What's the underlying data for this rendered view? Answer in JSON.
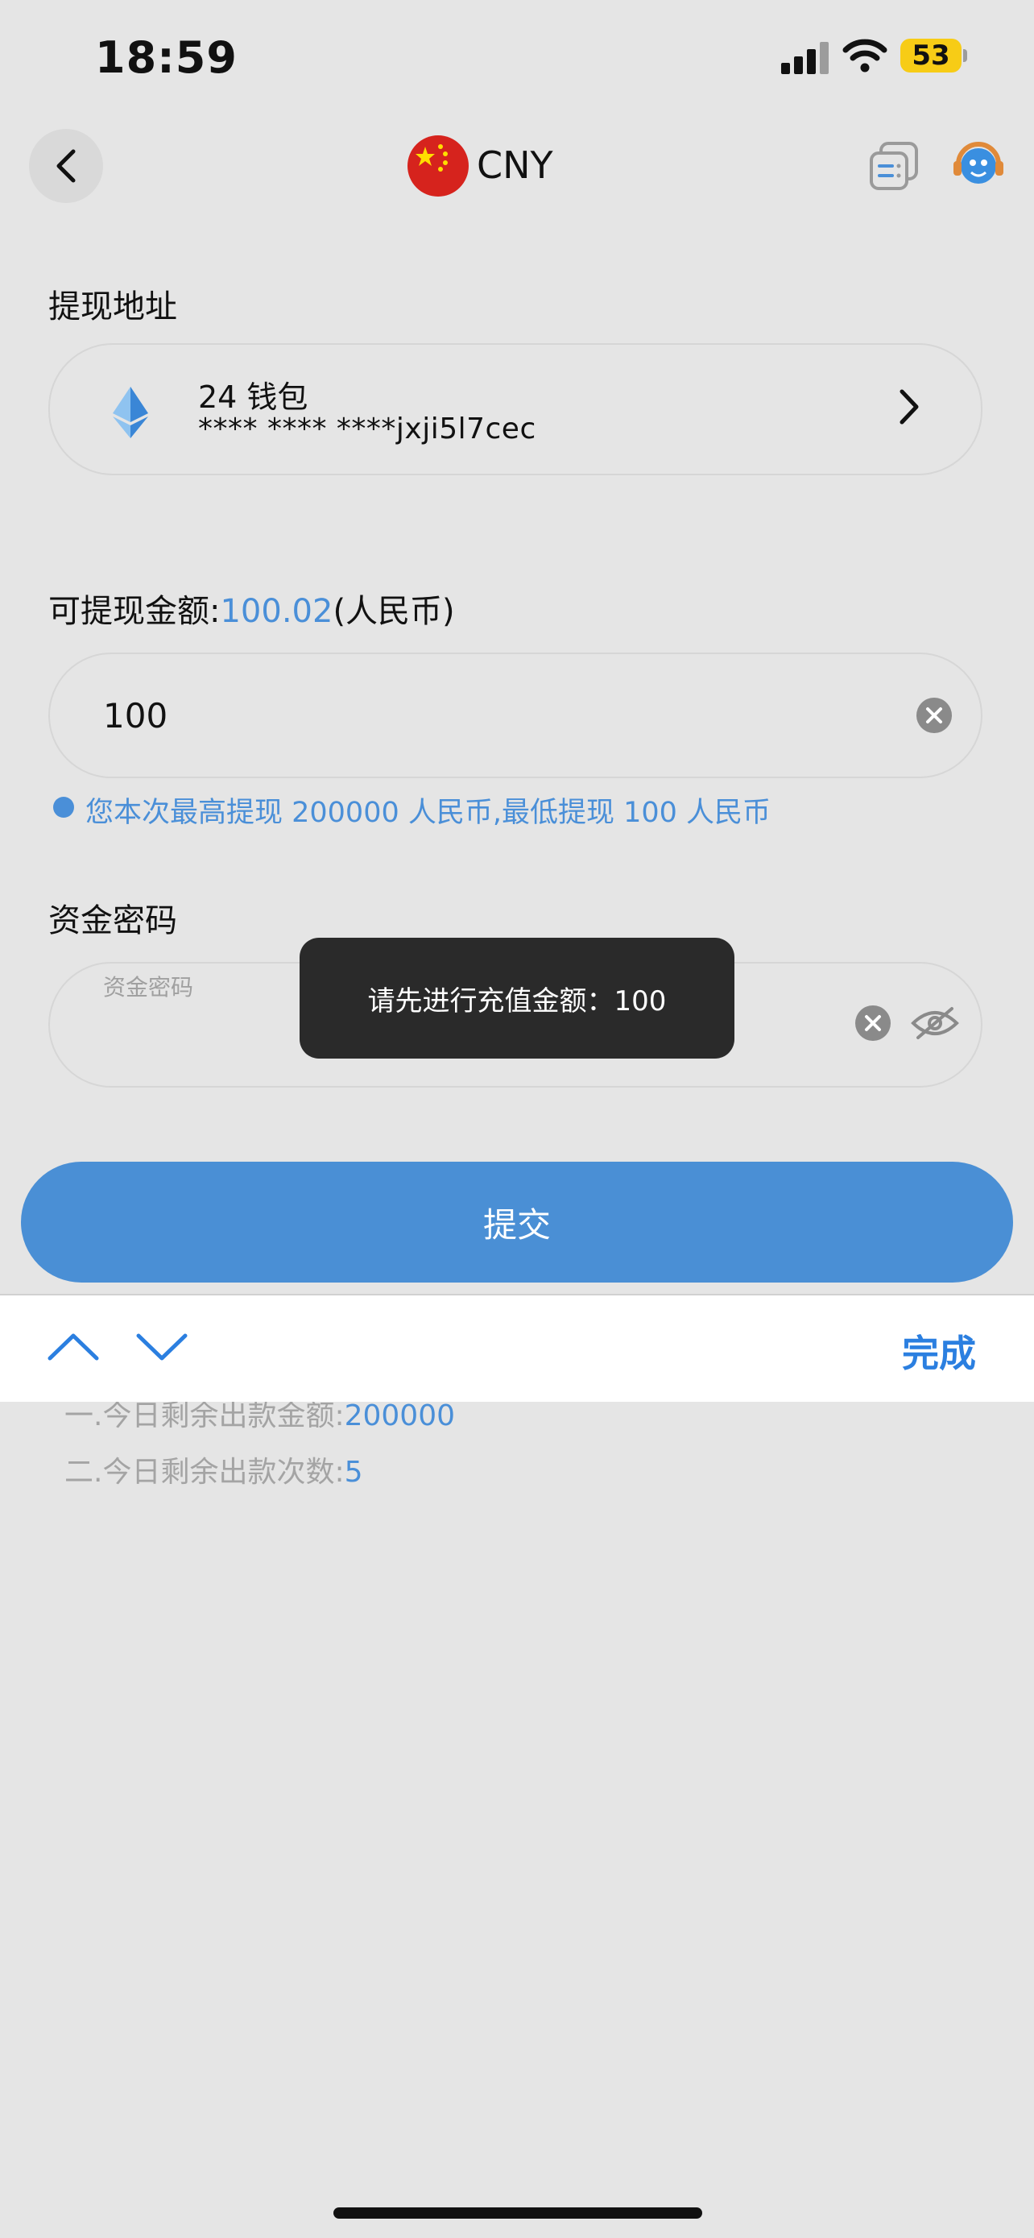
{
  "status_bar": {
    "time": "18:59",
    "battery": "53"
  },
  "nav": {
    "currency": "CNY"
  },
  "address_section": {
    "label": "提现地址",
    "wallet_name": "24 钱包",
    "wallet_address": "**** **** ****jxji5l7cec"
  },
  "amount_section": {
    "label_prefix": "可提现金额:",
    "available": "100.02",
    "label_suffix": "(人民币)",
    "input_value": "100",
    "hint": "您本次最高提现 200000 人民币,最低提现 100 人民币"
  },
  "password_section": {
    "label": "资金密码",
    "placeholder": "资金密码"
  },
  "toast": {
    "message": "请先进行充值金额：100"
  },
  "submit": {
    "label": "提交"
  },
  "keyboard_toolbar": {
    "done_label": "完成"
  },
  "stats": {
    "remaining_amount_label": "一.今日剩余出款金额:",
    "remaining_amount": "200000",
    "remaining_count_label": "二.今日剩余出款次数:",
    "remaining_count": "5"
  },
  "colors": {
    "accent": "#4a8fd8",
    "button": "#4a8fd5",
    "battery": "#f7cc16",
    "toast_bg": "#2a2a2a"
  }
}
